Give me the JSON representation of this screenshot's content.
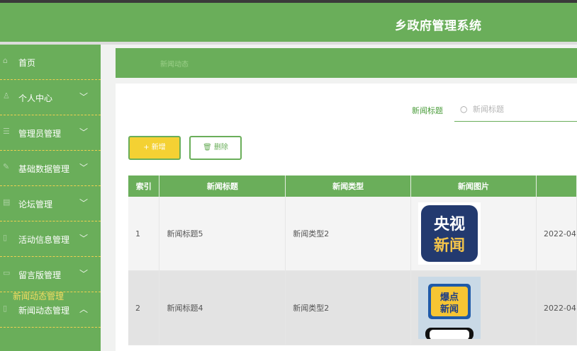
{
  "header": {
    "title": "乡政府管理系统"
  },
  "sidebar": {
    "items": [
      {
        "label": "首页",
        "icon": "home-icon",
        "chevron": ""
      },
      {
        "label": "个人中心",
        "icon": "user-icon",
        "chevron": "﹀"
      },
      {
        "label": "管理员管理",
        "icon": "admin-icon",
        "chevron": "﹀"
      },
      {
        "label": "基础数据管理",
        "icon": "data-icon",
        "chevron": "﹀"
      },
      {
        "label": "论坛管理",
        "icon": "forum-icon",
        "chevron": "﹀"
      },
      {
        "label": "活动信息管理",
        "icon": "activity-icon",
        "chevron": "﹀"
      },
      {
        "label": "留言版管理",
        "icon": "message-icon",
        "chevron": "﹀"
      },
      {
        "label": "新闻动态管理",
        "icon": "news-icon",
        "chevron": "︿"
      }
    ],
    "sub_item": "新闻动态管理"
  },
  "breadcrumb": {
    "current": "新闻动态"
  },
  "search": {
    "label": "新闻标题",
    "placeholder": "新闻标题"
  },
  "toolbar": {
    "add_label": "+ 新增",
    "delete_label": "🗑 删除"
  },
  "table": {
    "headers": [
      "索引",
      "新闻标题",
      "新闻类型",
      "新闻图片",
      ""
    ],
    "rows": [
      {
        "index": "1",
        "title": "新闻标题5",
        "type": "新闻类型2",
        "image": "央视新闻",
        "date": "2022-04"
      },
      {
        "index": "2",
        "title": "新闻标题4",
        "type": "新闻类型2",
        "image": "爆点新闻",
        "date": "2022-04"
      }
    ]
  },
  "colors": {
    "primary_green": "#6aae5a",
    "accent_yellow": "#f4d133",
    "header_dark": "#3a3a3a"
  }
}
